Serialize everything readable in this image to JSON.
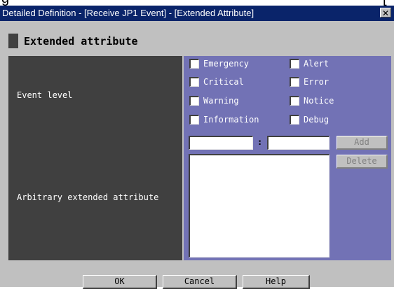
{
  "top_fragment": "g                                                          [",
  "window": {
    "title": "Detailed Definition - [Receive JP1 Event] - [Extended Attribute]",
    "close_glyph": "✕"
  },
  "section_title": "Extended attribute",
  "event_level": {
    "label": "Event level",
    "checkboxes": [
      {
        "label": "Emergency",
        "checked": false
      },
      {
        "label": "Alert",
        "checked": false
      },
      {
        "label": "Critical",
        "checked": false
      },
      {
        "label": "Error",
        "checked": false
      },
      {
        "label": "Warning",
        "checked": false
      },
      {
        "label": "Notice",
        "checked": false
      },
      {
        "label": "Information",
        "checked": false
      },
      {
        "label": "Debug",
        "checked": false
      }
    ]
  },
  "arbitrary": {
    "label": "Arbitrary extended attribute",
    "name_value": "",
    "separator": ":",
    "attr_value": "",
    "add_label": "Add",
    "delete_label": "Delete"
  },
  "buttons": {
    "ok": "OK",
    "cancel": "Cancel",
    "help": "Help"
  }
}
